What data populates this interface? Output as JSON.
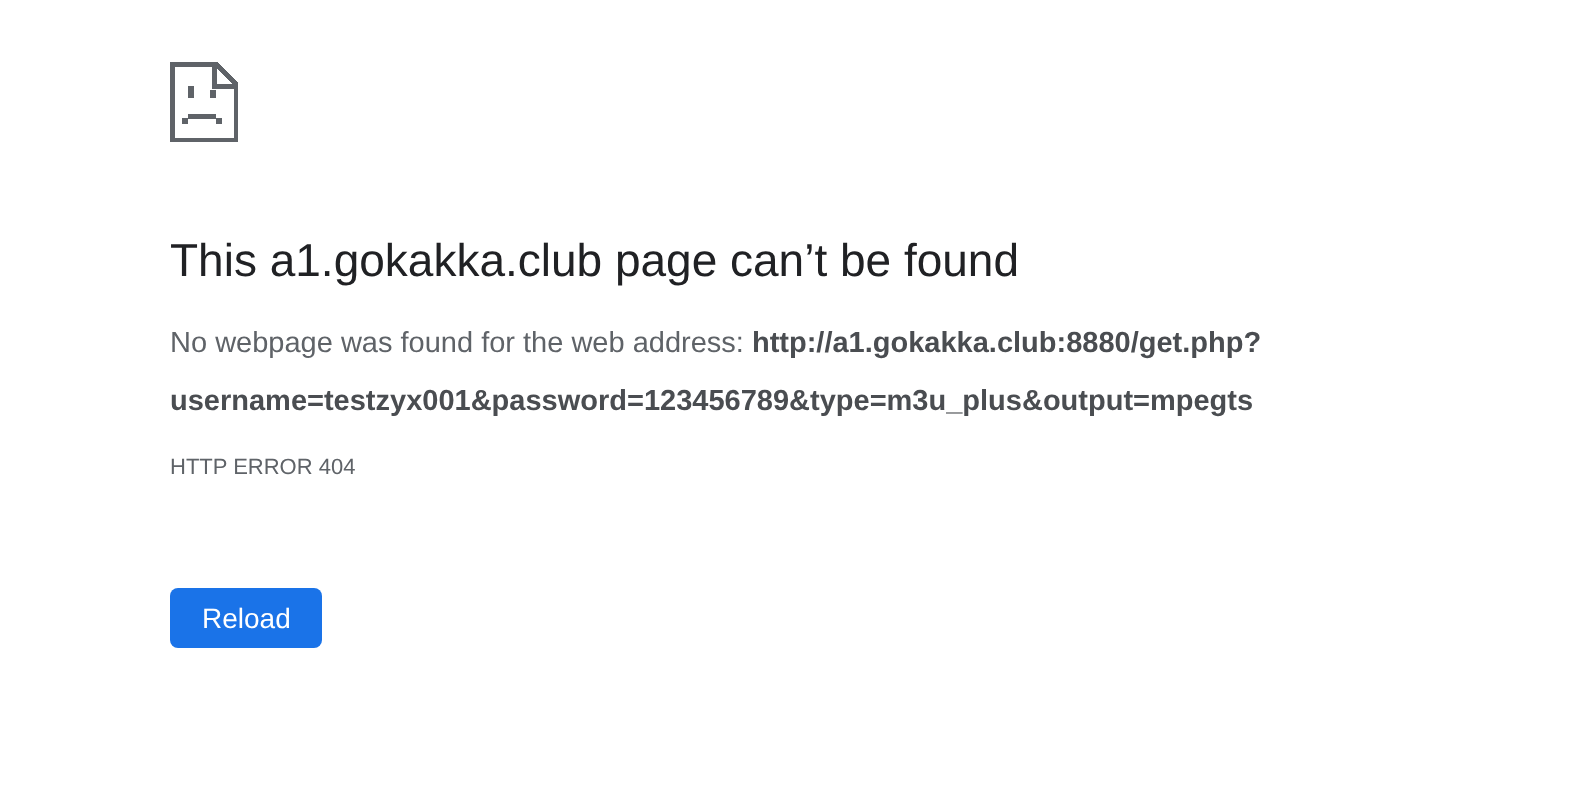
{
  "title": "This a1.gokakka.club page can’t be found",
  "message": "No webpage was found for the web address: **http://a1.gokakka.club:8880/get.php?username=testzyx001&password=123456789&type=m3u_plus&output=mpegts**",
  "error_code": "HTTP ERROR 404",
  "buttons": [
    {
      "label": "Reload",
      "kind": "primary"
    }
  ]
}
